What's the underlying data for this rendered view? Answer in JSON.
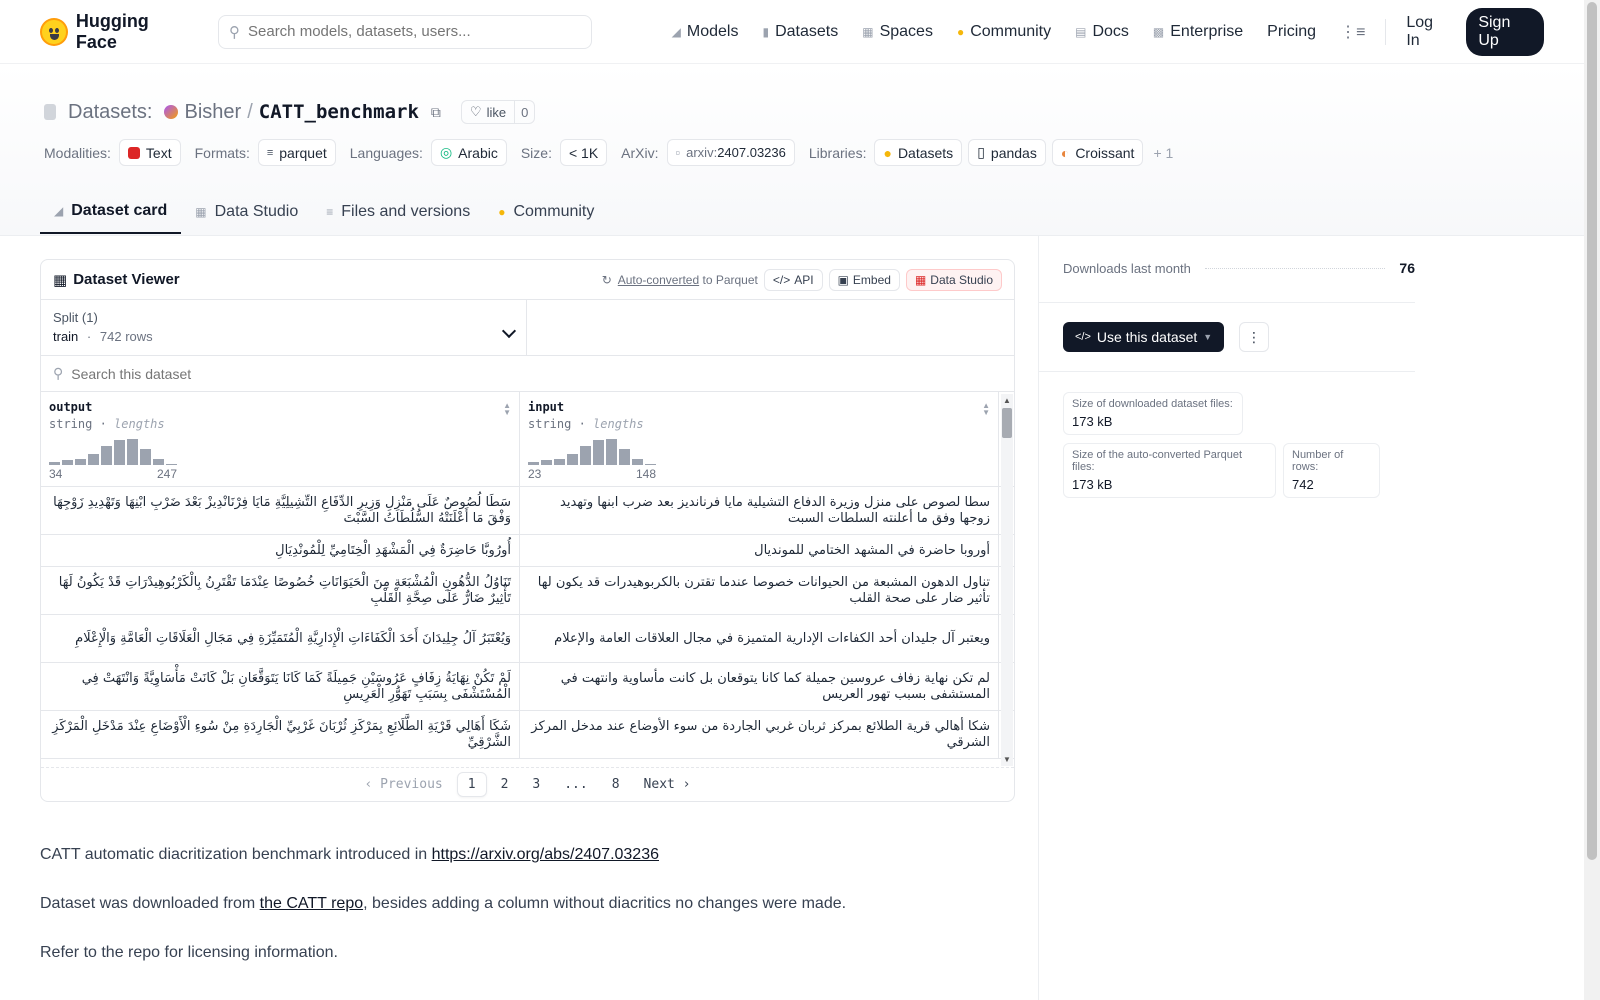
{
  "nav": {
    "brand": "Hugging Face",
    "search_placeholder": "Search models, datasets, users...",
    "links": [
      {
        "label": "Models",
        "icon": "cube-icon"
      },
      {
        "label": "Datasets",
        "icon": "database-icon"
      },
      {
        "label": "Spaces",
        "icon": "grid-icon"
      },
      {
        "label": "Community",
        "icon": "emoji-icon"
      },
      {
        "label": "Docs",
        "icon": "book-icon"
      },
      {
        "label": "Enterprise",
        "icon": "building-icon"
      },
      {
        "label": "Pricing",
        "icon": ""
      }
    ],
    "login": "Log In",
    "signup": "Sign Up"
  },
  "header": {
    "section": "Datasets:",
    "owner": "Bisher",
    "slash": "/",
    "name": "CATT_benchmark",
    "like_label": "like",
    "like_count": "0"
  },
  "meta": {
    "modalities_label": "Modalities:",
    "modality": "Text",
    "formats_label": "Formats:",
    "format": "parquet",
    "languages_label": "Languages:",
    "language": "Arabic",
    "size_label": "Size:",
    "size": "< 1K",
    "arxiv_label": "ArXiv:",
    "arxiv_prefix": "arxiv:",
    "arxiv_id": "2407.03236",
    "libraries_label": "Libraries:",
    "libraries": [
      "Datasets",
      "pandas",
      "Croissant"
    ],
    "more_libraries": "+ 1"
  },
  "tabs": [
    "Dataset card",
    "Data Studio",
    "Files and versions",
    "Community"
  ],
  "viewer": {
    "title": "Dataset Viewer",
    "auto_converted": "Auto-converted",
    "to_parquet": "to Parquet",
    "api": "API",
    "embed": "Embed",
    "data_studio": "Data Studio",
    "split_label": "Split (1)",
    "split_name": "train",
    "split_dot": "·",
    "split_rows": "742 rows",
    "search_placeholder": "Search this dataset",
    "columns": [
      {
        "name": "output",
        "type": "string",
        "stat": "lengths",
        "min": "34",
        "max": "247",
        "hist": [
          3,
          4,
          5,
          10,
          17,
          22,
          23,
          14,
          5,
          1
        ]
      },
      {
        "name": "input",
        "type": "string",
        "stat": "lengths",
        "min": "23",
        "max": "148",
        "hist": [
          3,
          4,
          5,
          10,
          17,
          22,
          23,
          14,
          5,
          1
        ]
      }
    ],
    "rows": [
      {
        "output": "سَطَا لُصُوصٌ عَلَى مَنْزِلِ وَزِيرِ الدِّفَاعِ التِّشِيلِيَّةِ مَايَا فِرْنَانْدِيزْ بَعْدَ ضَرْبِ ابْنِهَا وَتَهْدِيدِ زَوْجِهَا وَفْقَ مَا أَعْلَنَتْهُ السُّلُطَاتُ السَّبْتَ",
        "input": "سطا لصوص على منزل وزيرة الدفاع التشيلية مايا فرنانديز بعد ضرب ابنها وتهديد زوجها وفق ما أعلنته السلطات السبت"
      },
      {
        "output": "أُورُوبَّا حَاضِرَةٌ فِي الْمَشْهَدِ الْخِتَامِيِّ لِلْمُونْدِيَالِ",
        "input": "أوروبا حاضرة في المشهد الختامي للمونديال"
      },
      {
        "output": "تَنَاوُلُ الدُّهُونِ الْمُشْبَعَةِ مِنَ الْحَيَوَانَاتِ خُصُوصًا عِنْدَمَا تَقْتَرِنُ بِالْكَرْبُوهِيدْرَاتِ قَدْ يَكُونُ لَهَا تَأْثِيرٌ ضَارٌّ عَلَى صِحَّةِ الْقَلْبِ",
        "input": "تناول الدهون المشبعة من الحيوانات خصوصا عندما تقترن بالكربوهيدرات قد يكون لها تأثير ضار على صحة القلب"
      },
      {
        "output": "وَيُعْتَبَرُ آلُ جِلِيدَانَ أَحَدَ الْكَفَاءَاتِ الْإِدَارِيَّةِ الْمُتَمَيِّزَةِ فِي مَجَالِ الْعَلَاقَاتِ الْعَامَّةِ وَالْإِعْلَامِ",
        "input": "ويعتبر آل جليدان أحد الكفاءات الإدارية المتميزة في مجال العلاقات العامة والإعلام"
      },
      {
        "output": "لَمْ تَكُنْ نِهَايَةُ زِفَافٍ عَرُوسَيْنِ جَمِيلَةً كَمَا كَانَا يَتَوَقَّعَانِ بَلْ كَانَتْ مَأْسَاوِيَّةً وَانْتَهَتْ فِي الْمُسْتَشْفَى بِسَبَبِ تَهَوُّرِ الْعَرِيسِ",
        "input": "لم تكن نهاية زفاف عروسين جميلة كما كانا يتوقعان بل كانت مأساوية وانتهت في المستشفى بسبب تهور العريس"
      },
      {
        "output": "شَكَا أَهَالِي قَرْيَةِ الطَّلَائِعِ بِمَرْكَزِ ثُرْبَانَ غَرْبِيِّ الْجَارِدَةِ مِنْ سُوءِ الْأَوْضَاعِ عِنْدَ مَدْخَلِ الْمَرْكَزِ الشَّرْقِيِّ",
        "input": "شكا أهالي قرية الطلائع بمركز ثربان غربي الجاردة من سوء الأوضاع عند مدخل المركز الشرقي"
      }
    ],
    "pager": {
      "prev": "Previous",
      "pages": [
        "1",
        "2",
        "3",
        "...",
        "8"
      ],
      "next": "Next"
    }
  },
  "readme": {
    "p1_text": "CATT automatic diacritization benchmark introduced in ",
    "p1_link": "https://arxiv.org/abs/2407.03236",
    "p2_pre": "Dataset was downloaded from ",
    "p2_link": "the CATT repo",
    "p2_post": ", besides adding a column without diacritics no changes were made.",
    "p3": "Refer to the repo for licensing information."
  },
  "sidebar": {
    "downloads_label": "Downloads last month",
    "downloads_value": "76",
    "use_button": "Use this dataset",
    "size_downloaded_label": "Size of downloaded dataset files:",
    "size_downloaded": "173 kB",
    "size_parquet_label": "Size of the auto-converted Parquet files:",
    "size_parquet": "173 kB",
    "num_rows_label": "Number of rows:",
    "num_rows": "742"
  }
}
